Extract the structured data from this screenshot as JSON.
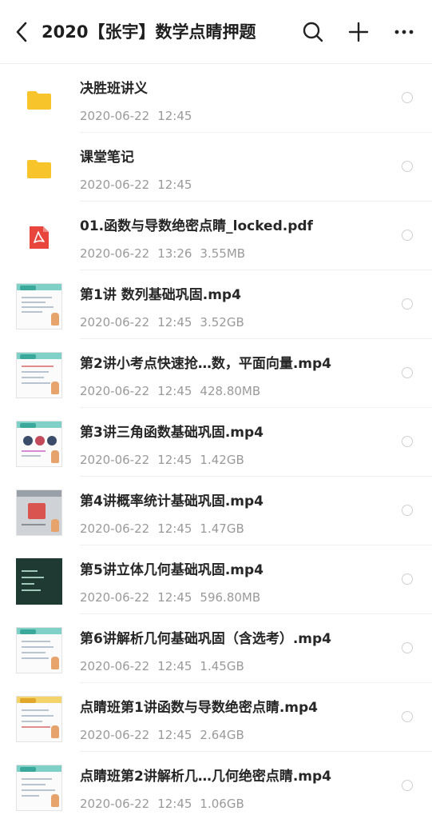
{
  "header": {
    "title": "2020【张宇】数学点睛押题",
    "back_icon": "chevron-left-icon",
    "actions": [
      "search-icon",
      "plus-icon",
      "more-icon"
    ]
  },
  "files": [
    {
      "name": "决胜班讲义",
      "date": "2020-06-22",
      "time": "12:45",
      "size": "",
      "kind": "folder"
    },
    {
      "name": "课堂笔记",
      "date": "2020-06-22",
      "time": "12:45",
      "size": "",
      "kind": "folder"
    },
    {
      "name": "01.函数与导数绝密点睛_locked.pdf",
      "date": "2020-06-22",
      "time": "13:26",
      "size": "3.55MB",
      "kind": "pdf"
    },
    {
      "name": "第1讲 数列基础巩固.mp4",
      "date": "2020-06-22",
      "time": "12:45",
      "size": "3.52GB",
      "kind": "video"
    },
    {
      "name": "第2讲小考点快速抢…数，平面向量.mp4",
      "date": "2020-06-22",
      "time": "12:45",
      "size": "428.80MB",
      "kind": "video"
    },
    {
      "name": "第3讲三角函数基础巩固.mp4",
      "date": "2020-06-22",
      "time": "12:45",
      "size": "1.42GB",
      "kind": "video"
    },
    {
      "name": "第4讲概率统计基础巩固.mp4",
      "date": "2020-06-22",
      "time": "12:45",
      "size": "1.47GB",
      "kind": "video"
    },
    {
      "name": "第5讲立体几何基础巩固.mp4",
      "date": "2020-06-22",
      "time": "12:45",
      "size": "596.80MB",
      "kind": "video"
    },
    {
      "name": "第6讲解析几何基础巩固（含选考）.mp4",
      "date": "2020-06-22",
      "time": "12:45",
      "size": "1.45GB",
      "kind": "video"
    },
    {
      "name": "点睛班第1讲函数与导数绝密点睛.mp4",
      "date": "2020-06-22",
      "time": "12:45",
      "size": "2.64GB",
      "kind": "video"
    },
    {
      "name": "点睛班第2讲解析几…几何绝密点睛.mp4",
      "date": "2020-06-22",
      "time": "12:45",
      "size": "1.06GB",
      "kind": "video"
    }
  ],
  "colors": {
    "folder": "#f7c52b",
    "pdf": "#e8453c",
    "radio": "#cfcfcf",
    "meta_text": "#9a9a9a"
  }
}
